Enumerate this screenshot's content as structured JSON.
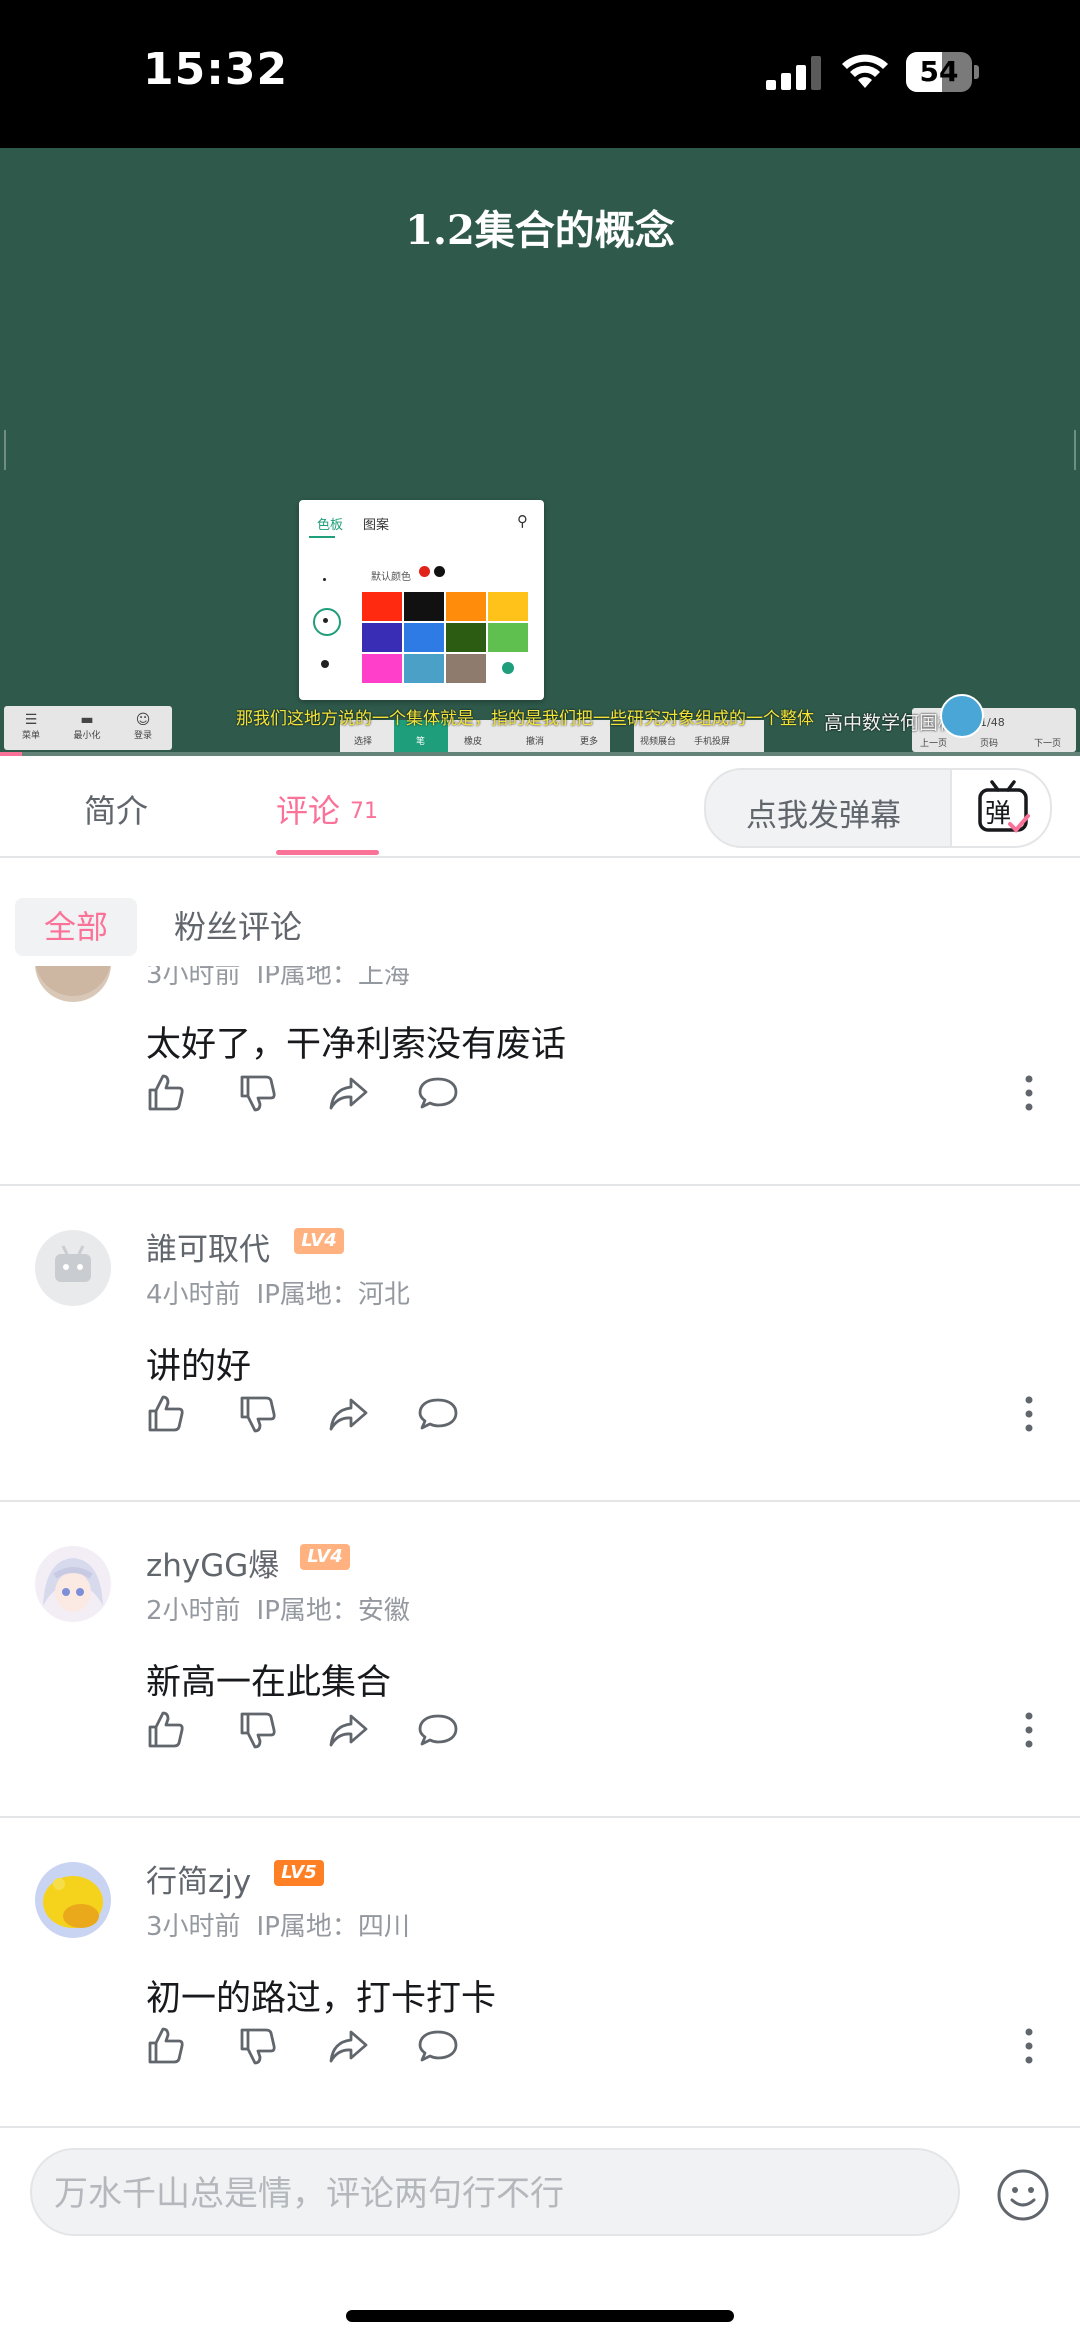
{
  "status_bar": {
    "time": "15:32",
    "battery": "54",
    "battery_level": 0.54
  },
  "video": {
    "slide_title": "1.2集合的概念",
    "subtitle": "那我们这地方说的一个集体就是，指的是我们把一些研究对象组成的一个整体",
    "watermark": "高中数学何国栋",
    "palette": {
      "tabs": [
        "色板",
        "图案"
      ],
      "default_color_label": "默认颜色",
      "colors": [
        "#ff2a0f",
        "#111111",
        "#ff8c0a",
        "#ffc21a",
        "#3a2db5",
        "#2f7be6",
        "#2c5b12",
        "#5fc04f",
        "#ff3ec9",
        "#4aa0c6",
        "#8f7b6e",
        "#ffffff"
      ]
    },
    "toolbar_left": [
      "菜单",
      "最小化",
      "登录"
    ],
    "toolbar_mid": [
      "选择",
      "笔",
      "橡皮",
      "撤消",
      "更多"
    ],
    "toolbar_mid2": [
      "视频展台",
      "手机投屏"
    ],
    "toolbar_right": [
      "上一页",
      "1/48",
      "页码",
      "下一页"
    ],
    "progress": 0.02
  },
  "tabs": {
    "intro": "简介",
    "comments": "评论",
    "comments_count": "71",
    "danmaku_placeholder": "点我发弹幕",
    "danmaku_button": "弹"
  },
  "filters": {
    "all": "全部",
    "fans": "粉丝评论"
  },
  "comments": [
    {
      "username": "",
      "level": "",
      "time": "3小时前",
      "ip_label": "IP属地：",
      "ip": "上海",
      "content": "太好了，干净利索没有废话"
    },
    {
      "username": "誰可取代",
      "level": "LV4",
      "time": "4小时前",
      "ip_label": "IP属地：",
      "ip": "河北",
      "content": "讲的好"
    },
    {
      "username": "zhyGG爆",
      "level": "LV4",
      "time": "2小时前",
      "ip_label": "IP属地：",
      "ip": "安徽",
      "content": "新高一在此集合"
    },
    {
      "username": "行简zjy",
      "level": "LV5",
      "time": "3小时前",
      "ip_label": "IP属地：",
      "ip": "四川",
      "content": "初一的路过，打卡打卡"
    }
  ],
  "level_colors": {
    "LV4": "#ffb27f",
    "LV5": "#ff7f24"
  },
  "icons": [
    "like-icon",
    "dislike-icon",
    "share-icon",
    "reply-icon",
    "more-icon",
    "emoji-icon"
  ],
  "input": {
    "placeholder": "万水千山总是情，评论两句行不行"
  },
  "accent_color": "#fb7299"
}
